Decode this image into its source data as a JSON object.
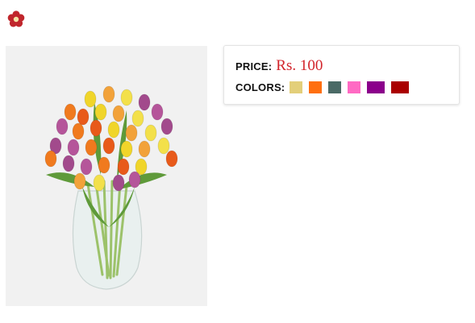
{
  "logo": {
    "icon": "red-flower-icon",
    "color": "#c0262c"
  },
  "product_image": {
    "subject": "tulip-bouquet-in-glass-vase"
  },
  "details": {
    "price_label": "PRICE:",
    "price_value": "Rs. 100",
    "colors_label": "COLORS:",
    "colors": [
      {
        "name": "yellow",
        "hex": "#e3cf7a"
      },
      {
        "name": "orange",
        "hex": "#ff6f0f"
      },
      {
        "name": "dark-teal-gray",
        "hex": "#4a6a66"
      },
      {
        "name": "pink",
        "hex": "#ff6ac3"
      },
      {
        "name": "purple",
        "hex": "#8b008b"
      },
      {
        "name": "dark-red",
        "hex": "#aa0000"
      }
    ]
  }
}
